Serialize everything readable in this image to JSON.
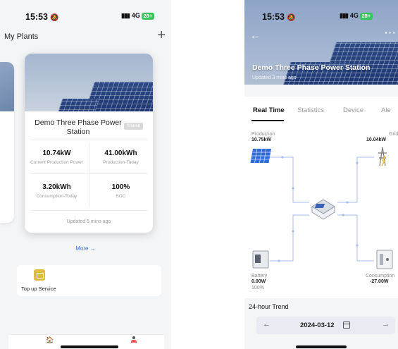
{
  "left": {
    "status": {
      "time": "15:53",
      "network": "4G",
      "battery": "28+"
    },
    "header": {
      "title": "My Plants",
      "add_label": "+"
    },
    "plant_card": {
      "name": "Demo Three Phase Power Station",
      "badge": "Shared",
      "metrics": [
        {
          "value": "10.74kW",
          "label": "Current Production Power"
        },
        {
          "value": "41.00kWh",
          "label": "Production-Today"
        },
        {
          "value": "3.20kWh",
          "label": "Consumption-Today"
        },
        {
          "value": "100%",
          "label": "SOC"
        }
      ],
      "updated": "Updated 5 mins ago"
    },
    "more_label": "More →",
    "service": {
      "label": "Top up Service"
    }
  },
  "right": {
    "status": {
      "time": "15:53",
      "network": "4G",
      "battery": "28+"
    },
    "hero": {
      "title": "Demo Three Phase Power Station",
      "subtitle": "Updated 3 mins ago"
    },
    "tabs": [
      "Real Time",
      "Statistics",
      "Device",
      "Ale"
    ],
    "flow": {
      "production": {
        "label": "Production",
        "value": "10.75kW"
      },
      "grid": {
        "label": "Grid",
        "value": "10.04kW"
      },
      "battery": {
        "label": "Battery",
        "value": "0.00W",
        "soc": "100%"
      },
      "consumption": {
        "label": "Consumption",
        "value": "-27.00W"
      }
    },
    "trend": {
      "title": "24-hour Trend",
      "date": "2024-03-12",
      "prev": "←",
      "next": "→"
    }
  },
  "colors": {
    "accent": "#3b6fe0",
    "flow_line": "#a7bde8",
    "battery_green": "#34c759",
    "service_yellow": "#e2b940"
  }
}
